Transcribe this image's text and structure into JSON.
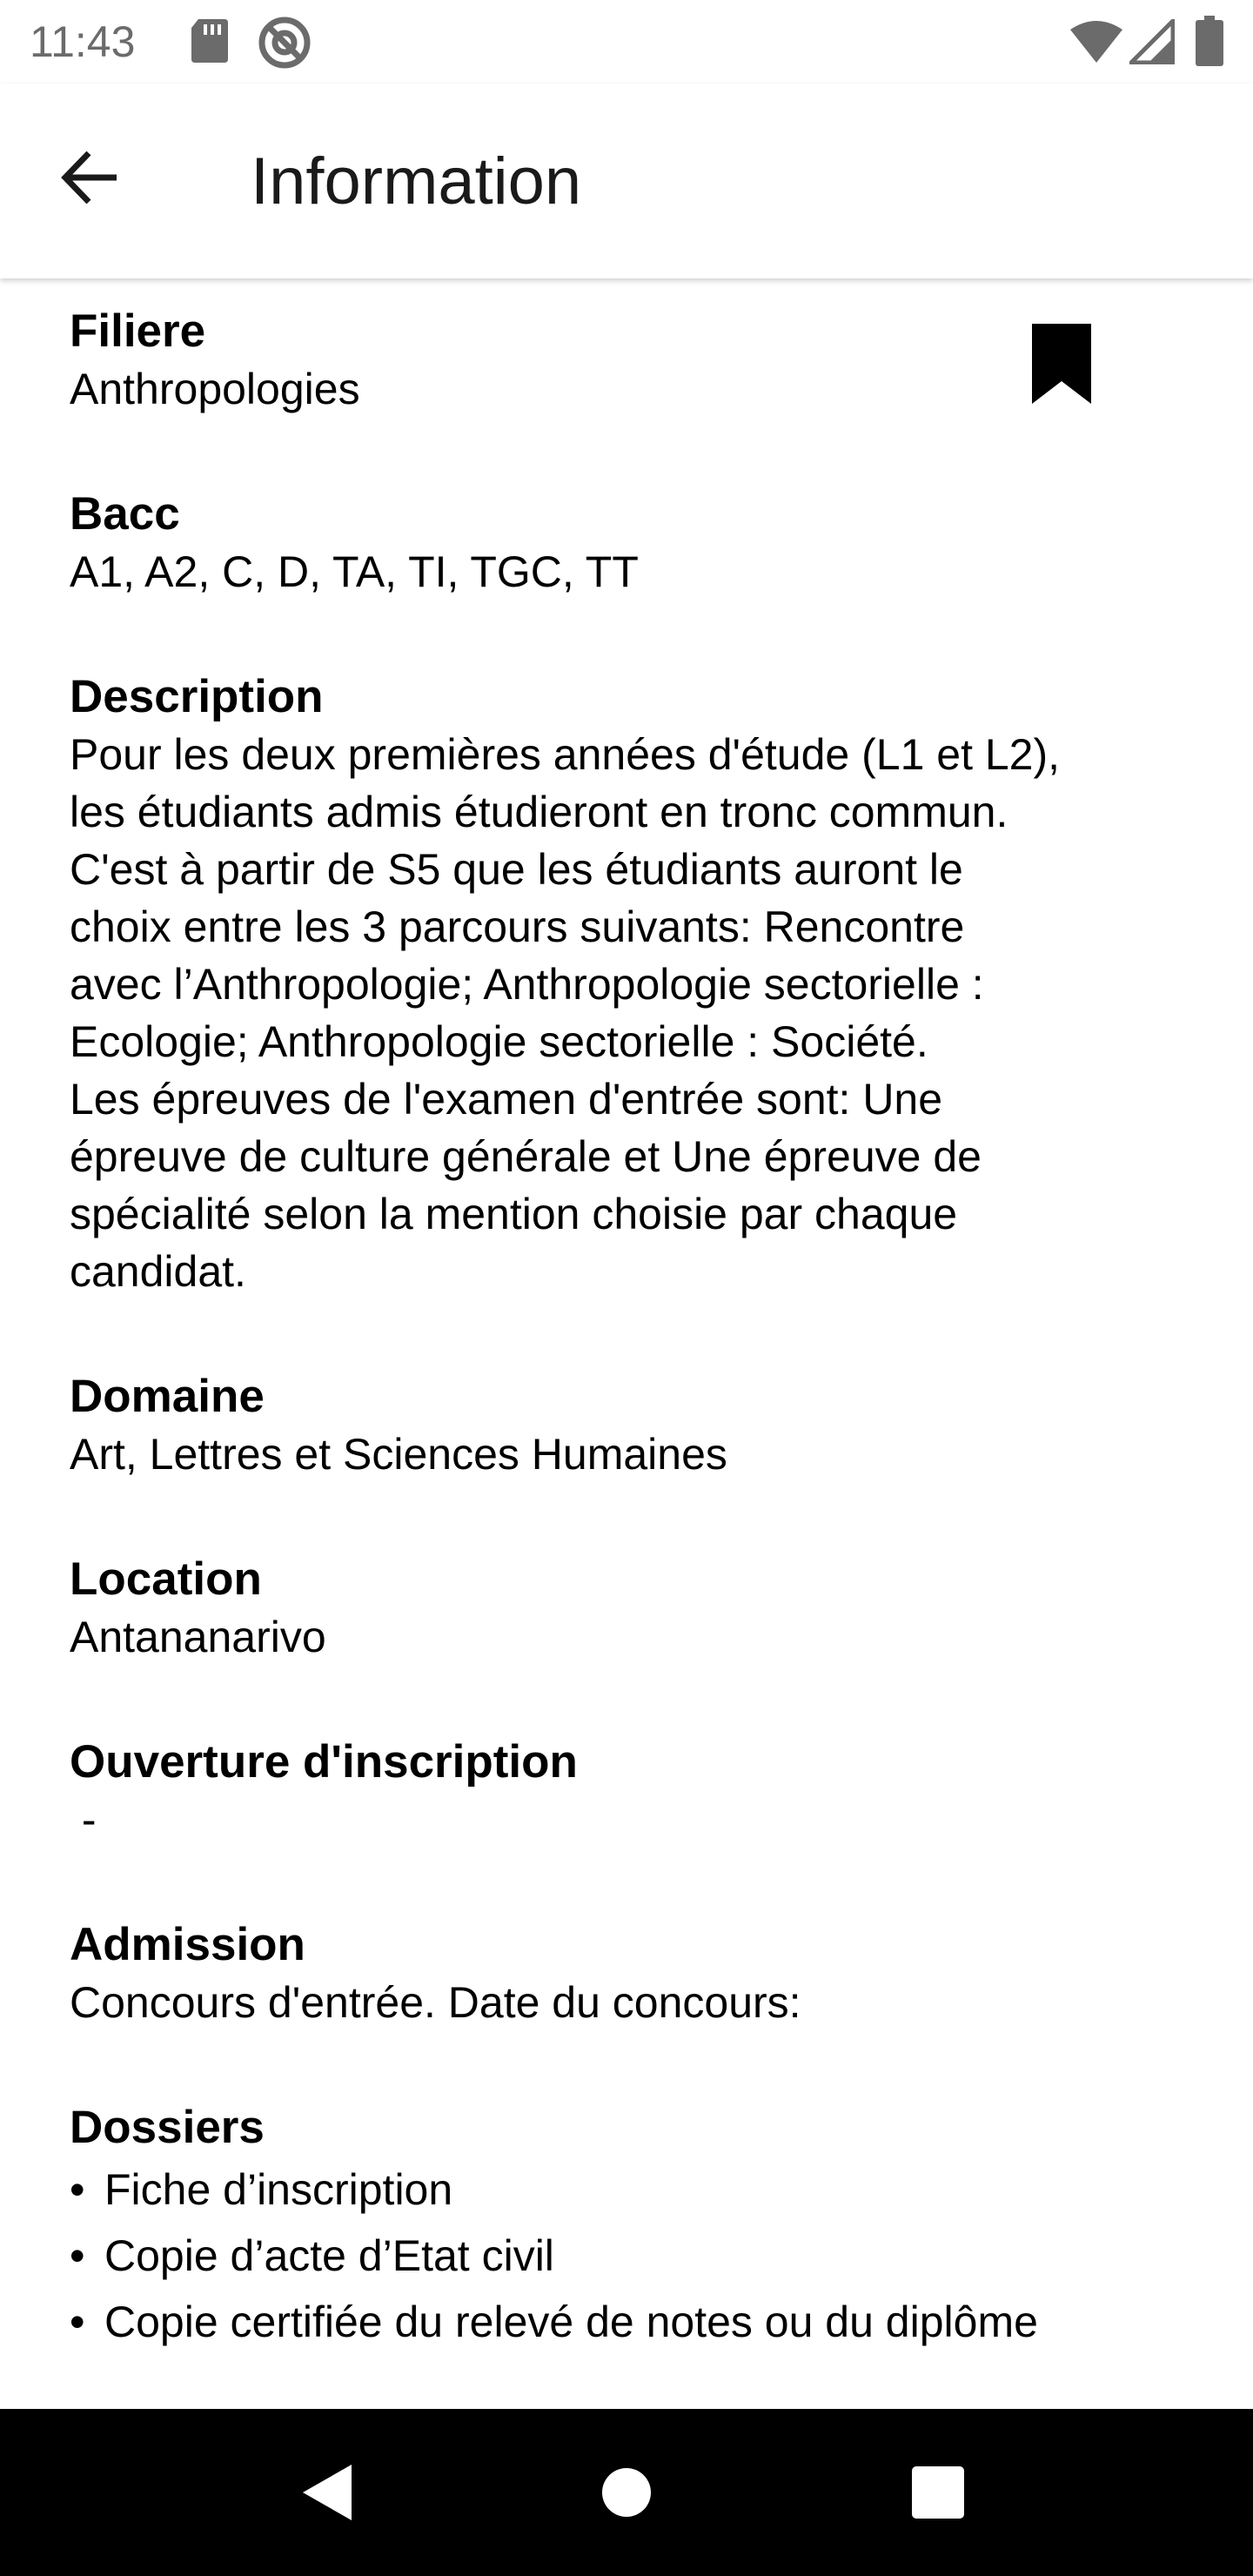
{
  "status_bar": {
    "time": "11:43",
    "icons": [
      "sd-card-icon",
      "at-sign-icon",
      "wifi-icon",
      "signal-icon",
      "battery-icon"
    ]
  },
  "app_bar": {
    "title": "Information",
    "back_icon": "arrow-back-icon"
  },
  "bookmark": {
    "icon": "bookmark-icon",
    "color": "#000000"
  },
  "sections": {
    "filiere": {
      "label": "Filiere",
      "value": "Anthropologies"
    },
    "bacc": {
      "label": "Bacc",
      "value": "A1, A2, C, D, TA, TI, TGC, TT"
    },
    "description": {
      "label": "Description",
      "value": "Pour les deux premières années d'étude (L1 et L2),\nles étudiants admis étudieront en tronc commun.\nC'est à partir de S5 que les étudiants auront le\nchoix entre les 3 parcours suivants: Rencontre\navec l’Anthropologie; Anthropologie sectorielle :\nEcologie; Anthropologie sectorielle : Société.\nLes épreuves de l'examen d'entrée sont: Une\népreuve de culture générale et Une épreuve de\nspécialité selon la mention choisie par chaque\ncandidat."
    },
    "domaine": {
      "label": "Domaine",
      "value": "Art, Lettres et Sciences Humaines"
    },
    "location": {
      "label": "Location",
      "value": "Antananarivo"
    },
    "ouverture": {
      "label": "Ouverture d'inscription",
      "value": " -"
    },
    "admission": {
      "label": "Admission",
      "value": "Concours d'entrée. Date du concours:"
    },
    "dossiers": {
      "label": "Dossiers",
      "bullet": "•",
      "items": [
        "Fiche d’inscription",
        "Copie d’acte d’Etat civil",
        "Copie certifiée du relevé de notes ou du diplôme"
      ]
    }
  },
  "nav_bar": {
    "back_icon": "nav-back-triangle-icon",
    "home_icon": "nav-home-circle-icon",
    "recents_icon": "nav-recents-square-icon"
  }
}
